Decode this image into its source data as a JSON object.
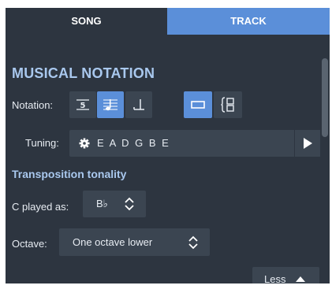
{
  "tabs": {
    "song": "SONG",
    "track": "TRACK"
  },
  "section_title": "MUSICAL NOTATION",
  "notation": {
    "label": "Notation:",
    "buttons": [
      {
        "icon": "tab-number-icon",
        "active": false
      },
      {
        "icon": "standard-notation-icon",
        "active": true
      },
      {
        "icon": "rhythm-note-icon",
        "active": false
      },
      {
        "icon": "single-line-view-icon",
        "active": true
      },
      {
        "icon": "multi-line-view-icon",
        "active": false
      }
    ]
  },
  "tuning": {
    "label": "Tuning:",
    "value": "E A D G B E"
  },
  "transposition": {
    "title": "Transposition tonality",
    "c_played_label": "C played as:",
    "c_played_value": "B♭"
  },
  "octave": {
    "label": "Octave:",
    "value": "One octave lower"
  },
  "less_button": "Less",
  "colors": {
    "panel_bg": "#2d3540",
    "accent": "#5b8fd9",
    "control_bg": "#3b4551",
    "heading": "#a9c8ee"
  }
}
